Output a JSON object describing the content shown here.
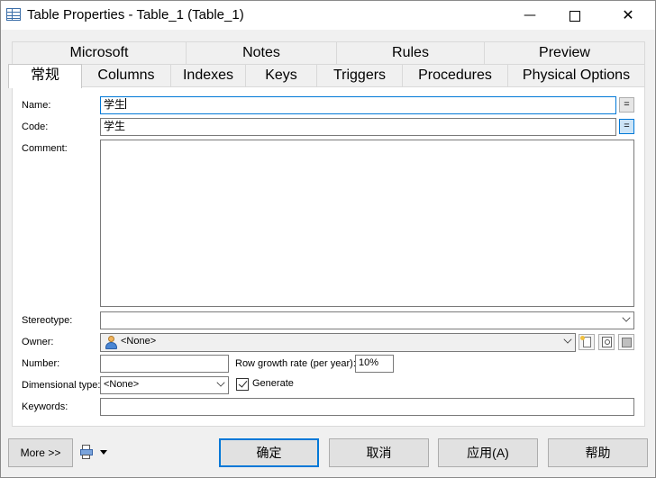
{
  "window": {
    "title": "Table Properties - Table_1 (Table_1)",
    "minimize_glyph": "—",
    "maximize_glyph": "☐",
    "close_glyph": "✕"
  },
  "tabs": {
    "row_top": [
      "Microsoft",
      "Notes",
      "Rules",
      "Preview"
    ],
    "row_bottom": [
      "常规",
      "Columns",
      "Indexes",
      "Keys",
      "Triggers",
      "Procedures",
      "Physical Options"
    ],
    "active": "常规"
  },
  "general": {
    "name_label": "Name:",
    "name_value": "学生",
    "code_label": "Code:",
    "code_value": "学生",
    "equals_glyph": "=",
    "comment_label": "Comment:",
    "comment_value": "",
    "stereotype_label": "Stereotype:",
    "stereotype_value": "",
    "owner_label": "Owner:",
    "owner_value": "<None>",
    "number_label": "Number:",
    "number_value": "",
    "row_growth_label": "Row growth rate (per year):",
    "row_growth_value": "10%",
    "dimensional_label": "Dimensional type:",
    "dimensional_value": "<None>",
    "generate_label": "Generate",
    "generate_checked": true,
    "keywords_label": "Keywords:",
    "keywords_value": ""
  },
  "footer": {
    "more_label": "More >>",
    "ok_label": "确定",
    "cancel_label": "取消",
    "apply_label": "应用(A)",
    "help_label": "帮助"
  },
  "colors": {
    "accent": "#0078d7",
    "window_bg": "#f0f0f0"
  }
}
